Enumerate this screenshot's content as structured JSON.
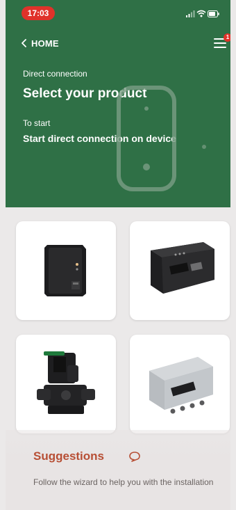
{
  "status_bar": {
    "time": "17:03",
    "time_pill_color": "#e0322a",
    "icons": [
      "signal-icon",
      "wifi-icon",
      "battery-icon"
    ]
  },
  "header": {
    "back_label": "HOME",
    "back_icon": "chevron-left-icon",
    "menu_icon": "hamburger-menu-icon",
    "notification_count": "1",
    "kicker": "Direct connection",
    "title": "Select your product",
    "start_label": "To start",
    "start_text": "Start direct connection on device",
    "background_color": "#2f7046",
    "illustration_icon": "device-outline-icon"
  },
  "products": [
    {
      "icon": "compact-black-device-icon"
    },
    {
      "icon": "black-control-panel-icon"
    },
    {
      "icon": "pump-unit-icon"
    },
    {
      "icon": "silver-control-box-icon"
    }
  ],
  "suggestions": {
    "title": "Suggestions",
    "icon": "chat-bubble-icon",
    "text": "Follow the wizard to help you with the installation",
    "accent_color": "#b74f35"
  }
}
